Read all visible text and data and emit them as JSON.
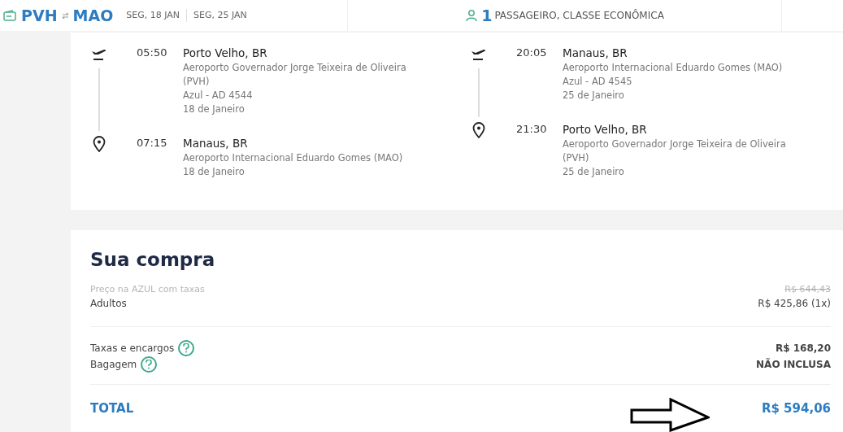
{
  "header": {
    "origin": "PVH",
    "destination": "MAO",
    "dates": [
      "SEG, 18 JAN",
      "SEG, 25 JAN"
    ],
    "passenger_count": "1",
    "passenger_text": "PASSAGEIRO, CLASSE ECONÔMICA"
  },
  "flights": [
    {
      "stops": [
        {
          "kind": "departure",
          "time": "05:50",
          "city": "Porto Velho, BR",
          "airport": "Aeroporto Governador Jorge Teixeira de Oliveira (PVH)",
          "flight": "Azul - AD 4544",
          "date": "18 de Janeiro"
        },
        {
          "kind": "arrival",
          "time": "07:15",
          "city": "Manaus, BR",
          "airport": "Aeroporto Internacional Eduardo Gomes (MAO)",
          "date": "18 de Janeiro"
        }
      ]
    },
    {
      "stops": [
        {
          "kind": "departure",
          "time": "20:05",
          "city": "Manaus, BR",
          "airport": "Aeroporto Internacional Eduardo Gomes (MAO)",
          "flight": "Azul - AD 4545",
          "date": "25 de Janeiro"
        },
        {
          "kind": "arrival",
          "time": "21:30",
          "city": "Porto Velho, BR",
          "airport": "Aeroporto Governador Jorge Teixeira de Oliveira (PVH)",
          "date": "25 de Janeiro"
        }
      ]
    }
  ],
  "purchase": {
    "title": "Sua compra",
    "reference_label": "Preço na AZUL com taxas",
    "reference_price": "R$ 644,43",
    "groups": [
      [
        {
          "label": "Adultos",
          "value": "R$ 425,86 (1x)",
          "help": false
        }
      ],
      [
        {
          "label": "Taxas e encargos",
          "value": "R$ 168,20",
          "help": true
        },
        {
          "label": "Bagagem",
          "value": "NÃO INCLUSA",
          "help": true
        }
      ]
    ],
    "total_label": "TOTAL",
    "total_value": "R$ 594,06"
  }
}
